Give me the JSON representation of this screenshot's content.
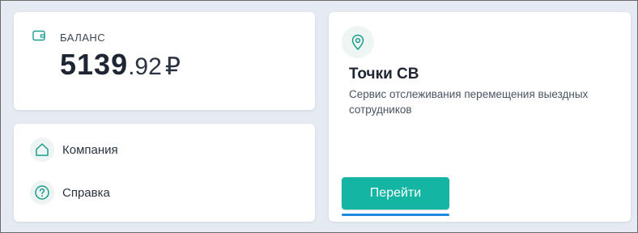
{
  "balance": {
    "label": "БАЛАНС",
    "integer_part": "5139",
    "fraction_part": ".92",
    "currency": "₽",
    "icon": "wallet-icon"
  },
  "menu": {
    "items": [
      {
        "label": "Компания",
        "icon": "home-icon"
      },
      {
        "label": "Справка",
        "icon": "help-circle-icon"
      }
    ]
  },
  "service": {
    "icon": "map-pin-icon",
    "title": "Точки СВ",
    "description": "Сервис отслеживания перемещения выездных сотрудников",
    "button_label": "Перейти"
  },
  "colors": {
    "accent": "#15b5a4",
    "focus": "#1e88e5",
    "page_background": "#e6eaf2",
    "icon_stroke": "#1a9c8c"
  }
}
